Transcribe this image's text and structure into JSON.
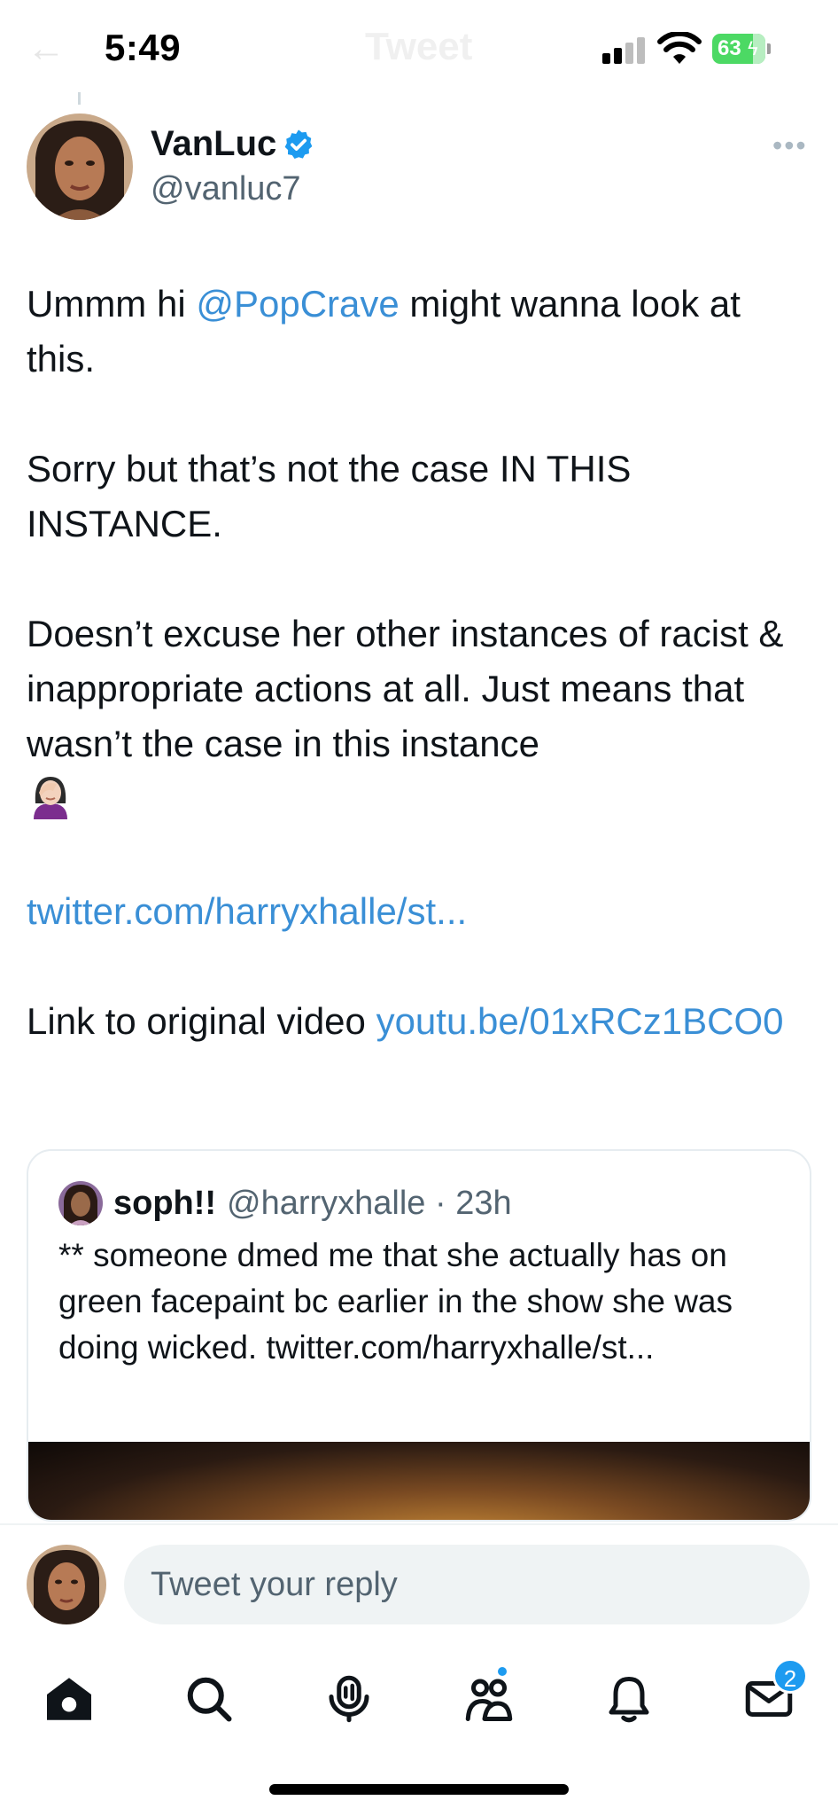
{
  "status_bar": {
    "time": "5:49",
    "battery": "63",
    "ghost_title": "Tweet"
  },
  "author": {
    "name": "VanLuc",
    "handle": "@vanluc7",
    "verified": true
  },
  "tweet": {
    "p1_before": "Ummm hi ",
    "p1_mention": "@PopCrave",
    "p1_after": " might wanna look at this.",
    "p2": "Sorry but that’s not the case IN THIS INSTANCE.",
    "p3": "Doesn’t excuse her other instances of racist & inappropriate actions at all. Just means that wasn’t the case in this instance",
    "p3_emoji": "facepalm-woman",
    "link1": "twitter.com/harryxhalle/st...",
    "p5_before": "Link to original video ",
    "p5_link": "youtu.be/01xRCz1BCO0"
  },
  "quote": {
    "name": "soph!!",
    "meta": "@harryxhalle · 23h",
    "text": "** someone dmed me that she actually has on green facepaint bc earlier in the show she was doing wicked. twitter.com/harryxhalle/st..."
  },
  "reply": {
    "placeholder": "Tweet your reply"
  },
  "tabs": {
    "messages_badge": "2"
  },
  "colors": {
    "link": "#3a8fd6",
    "verified": "#1d9bf0",
    "text": "#0f1419",
    "muted": "#536471"
  }
}
